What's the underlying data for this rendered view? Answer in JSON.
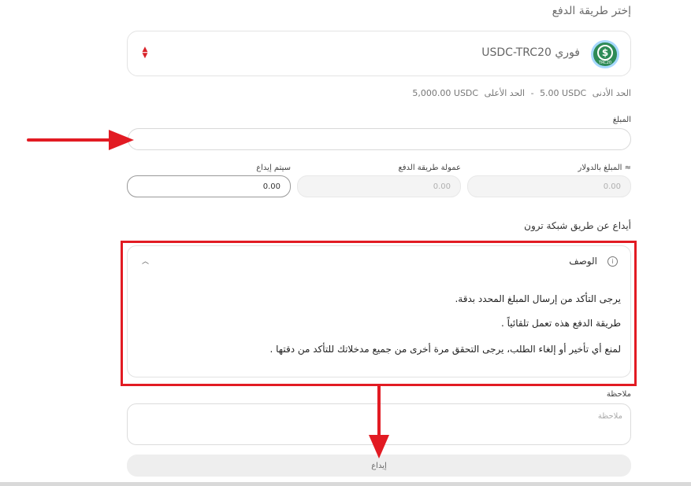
{
  "section_title": "إختر طريقة الدفع",
  "payment_method": {
    "name": "USDC-TRC20 فوري",
    "logo_text": "$",
    "logo_tag": "TRC20",
    "logo_icon": "usdc-trc20-logo"
  },
  "limits": {
    "min_label": "الحد الأدنى",
    "min_value": "5.00 USDC",
    "separator": "-",
    "max_label": "الحد الأعلى",
    "max_value": "5,000.00 USDC"
  },
  "amount": {
    "label": "المبلغ",
    "value": ""
  },
  "fields": {
    "usd_amount": {
      "label": "المبلغ بالدولار ≈",
      "value": "0.00"
    },
    "method_fee": {
      "label": "عمولة طريقة الدفع",
      "value": "0.00"
    },
    "to_deposit": {
      "label": "سيتم إيداع",
      "value": "0.00"
    }
  },
  "network_title": "أيداع عن طريق شبكة ترون",
  "description": {
    "title": "الوصف",
    "lines": [
      "يرجى التأكد من إرسال المبلغ المحدد بدقة.",
      "طريقة الدفع هذه تعمل تلقائياً .",
      "لمنع أي تأخير أو إلغاء الطلب، يرجى التحقق مرة أخرى من جميع مدخلاتك للتأكد من دقتها ."
    ]
  },
  "note": {
    "label": "ملاحظة",
    "placeholder": "ملاحظة",
    "value": ""
  },
  "deposit_button": {
    "label": "إيداع"
  },
  "colors": {
    "annotation_red": "#e21b23",
    "logo_green": "#2e8b57",
    "sort_icon_red": "#d9232a"
  }
}
